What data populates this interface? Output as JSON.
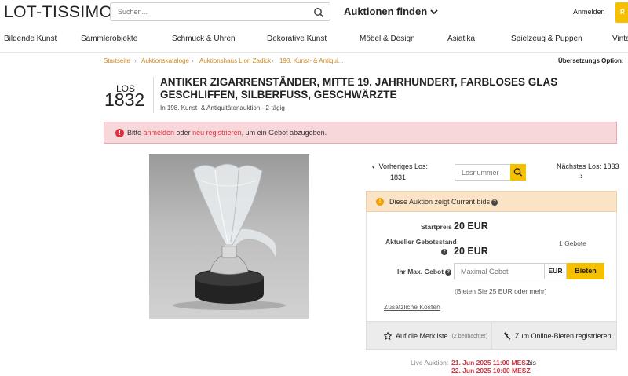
{
  "header": {
    "logo": "LOT-TISSIMO",
    "search_placeholder": "Suchen...",
    "auktionen_label": "Auktionen finden",
    "anmelden_label": "Anmelden",
    "cut_tab_label": "R"
  },
  "nav": [
    "Bildende Kunst",
    "Sammlerobjekte",
    "Schmuck & Uhren",
    "Dekorative Kunst",
    "Möbel & Design",
    "Asiatika",
    "Spielzeug & Puppen",
    "Vinta"
  ],
  "breadcrumb": [
    "Startseite",
    "Auktionskataloge",
    "Auktionshaus Lion Zadick",
    "198. Kunst- & Antiqui..."
  ],
  "translation_option": "Übersetzungs Option:",
  "lot": {
    "los_label": "LOS",
    "number": "1832",
    "title": "ANTIKER ZIGARRENSTÄNDER, MITTE 19. JAHRHUNDERT, FARBLOSES GLAS GESCHLIFFEN, SILBERFUSS, GESCHWÄRZTE",
    "in_label": "In",
    "auction_name": "198. Kunst- & Antiquitätenauktion - 2-tägig"
  },
  "alert": {
    "pre": "Bitte ",
    "link1": "anmelden",
    "mid": " oder ",
    "link2": "neu registrieren",
    "post": ", um ein Gebot abzugeben."
  },
  "lotnav": {
    "prev_label": "Vorheriges Los:",
    "prev_num": "1831",
    "input_placeholder": "Losnummer",
    "next_label": "Nächstes Los: 1833"
  },
  "bid": {
    "current_bids_notice": "Diese Auktion zeigt Current bids",
    "startpreis_label": "Startpreis",
    "startpreis_value": "20 EUR",
    "aktueller_label": "Aktueller Gebotsstand",
    "aktueller_value": "20 EUR",
    "gebote_count": "1 Gebote",
    "max_label": "Ihr Max. Gebot",
    "max_placeholder": "Maximal Gebot",
    "currency": "EUR",
    "bieten_label": "Bieten",
    "hint": "(Bieten Sie 25 EUR oder mehr)",
    "extra_costs": "Zusätzliche Kosten",
    "merkliste_label": "Auf die Merkliste",
    "merkliste_count": "(2 beobachter)",
    "register_label": "Zum Online-Bieten registrieren"
  },
  "live": {
    "label": "Live Auktion:",
    "start": "21. Jun 2025 11:00 MESZ",
    "bis": "bis",
    "end": "22. Jun 2025 10:00 MESZ"
  },
  "colors": {
    "accent_yellow": "#f5c000",
    "link_brown": "#c8892a",
    "alert_red": "#d9323f",
    "alert_bg": "#f8d7da",
    "notice_bg": "#fbe3c6"
  }
}
